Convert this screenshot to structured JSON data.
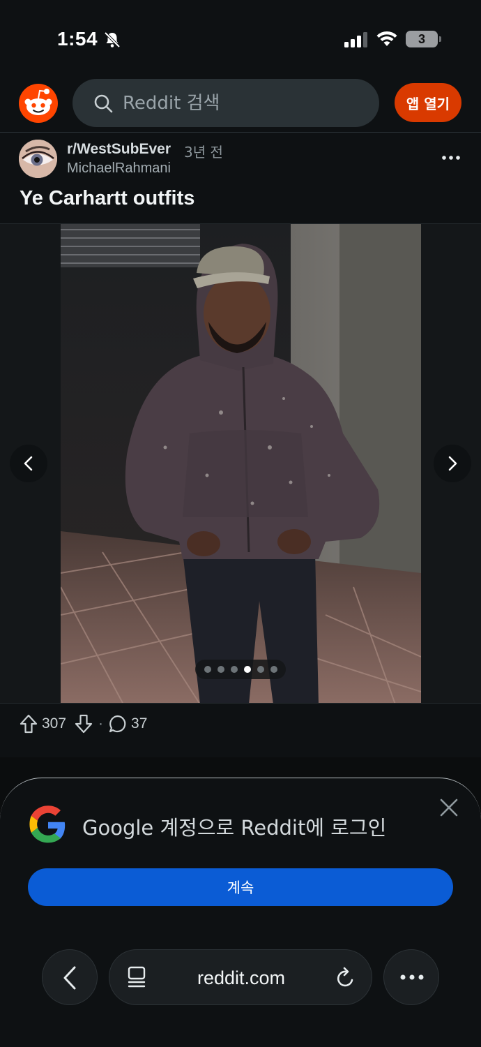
{
  "status_bar": {
    "time": "1:54",
    "battery": "3"
  },
  "header": {
    "search_placeholder": "Reddit 검색",
    "open_app_label": "앱 열기"
  },
  "post": {
    "subreddit": "r/WestSubEver",
    "time_ago": "3년 전",
    "author": "MichaelRahmani",
    "title": "Ye Carhartt outfits",
    "carousel": {
      "count": 6,
      "active_index": 3
    },
    "upvotes": "307",
    "separator": "·",
    "comments": "37"
  },
  "login_sheet": {
    "title": "Google 계정으로 Reddit에 로그인",
    "continue_label": "계속"
  },
  "browser": {
    "url": "reddit.com"
  },
  "colors": {
    "accent": "#d93a00",
    "google_button": "#0b5cd5"
  }
}
